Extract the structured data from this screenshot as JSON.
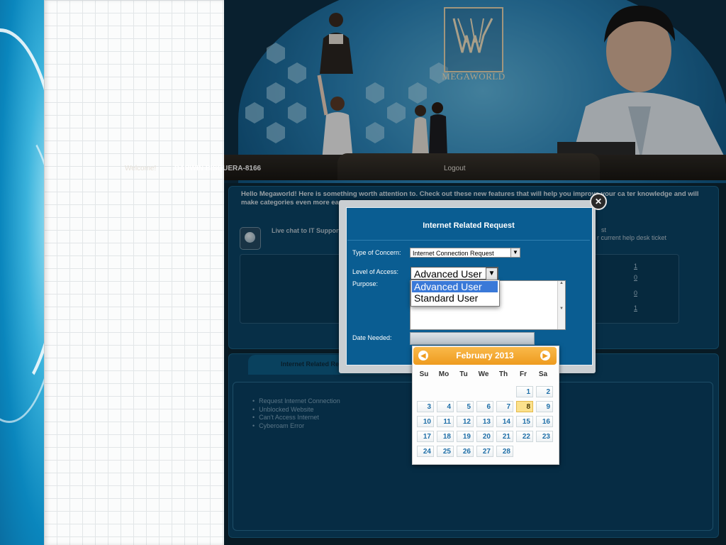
{
  "header": {
    "logo_text": "MEGAWORLD",
    "welcome_label": "Welcome!",
    "user_name": "DARWIN BISQUERA-8166",
    "logout_label": "Logout"
  },
  "notice": {
    "text": "Hello Megaworld! Here is something worth attention to. Check out these new features that will help you improve your ca        ter knowledge and will make categories even more easy.",
    "live_chat_label": "Live chat to IT Support",
    "right_snippet_1": "st",
    "right_snippet_2": "r current help desk ticket"
  },
  "stats": [
    "1",
    "0",
    "0",
    "1"
  ],
  "tab": {
    "label": "Internet Related Req",
    "items": [
      "Request Internet Connection",
      "Unblocked Website",
      "Can't Access Internet",
      "Cyberoam Error"
    ]
  },
  "dialog": {
    "title": "Internet Related Request",
    "close_icon": "close-icon",
    "type_of_concern_label": "Type of Concern:",
    "type_of_concern_value": "Internet Connection Request",
    "level_of_access_label": "Level of Access:",
    "level_of_access_value": "Advanced User",
    "level_of_access_options": [
      "Advanced User",
      "Standard User"
    ],
    "purpose_label": "Purpose:",
    "purpose_value": "",
    "date_needed_label": "Date Needed:",
    "date_needed_value": ""
  },
  "calendar": {
    "title": "February 2013",
    "prev_label": "◀",
    "next_label": "▶",
    "days_of_week": [
      "Su",
      "Mo",
      "Tu",
      "We",
      "Th",
      "Fr",
      "Sa"
    ],
    "first_weekday_index": 5,
    "days_in_month": 28,
    "highlighted_day": 8
  },
  "colors": {
    "accent_orange": "#ee9b1f",
    "dialog_blue": "#0a5d92",
    "selected_option": "#3a79d8"
  }
}
